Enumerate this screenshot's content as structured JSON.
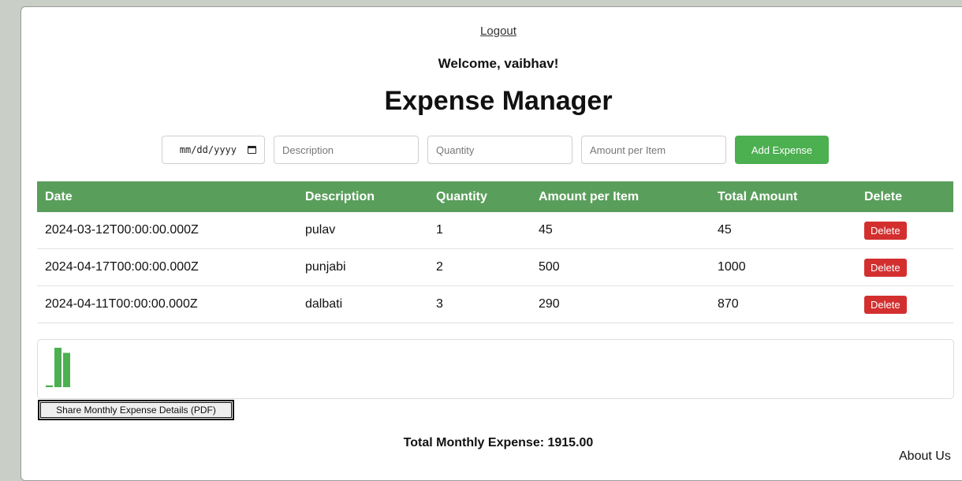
{
  "header": {
    "logout_label": "Logout",
    "welcome_text": "Welcome, vaibhav!",
    "title": "Expense Manager"
  },
  "form": {
    "date_placeholder": "mm/dd/yyyy",
    "description_placeholder": "Description",
    "quantity_placeholder": "Quantity",
    "amount_placeholder": "Amount per Item",
    "add_label": "Add Expense"
  },
  "table": {
    "columns": [
      "Date",
      "Description",
      "Quantity",
      "Amount per Item",
      "Total Amount",
      "Delete"
    ],
    "rows": [
      {
        "date": "2024-03-12T00:00:00.000Z",
        "description": "pulav",
        "quantity": "1",
        "amount": "45",
        "total": "45",
        "delete_label": "Delete"
      },
      {
        "date": "2024-04-17T00:00:00.000Z",
        "description": "punjabi",
        "quantity": "2",
        "amount": "500",
        "total": "1000",
        "delete_label": "Delete"
      },
      {
        "date": "2024-04-11T00:00:00.000Z",
        "description": "dalbati",
        "quantity": "3",
        "amount": "290",
        "total": "870",
        "delete_label": "Delete"
      }
    ]
  },
  "chart_data": {
    "type": "bar",
    "values": [
      45,
      1000,
      870
    ],
    "ylim": [
      0,
      1000
    ],
    "color": "#4caf50"
  },
  "share_label": "Share Monthly Expense Details (PDF)",
  "total_text": "Total Monthly Expense: 1915.00",
  "footer": {
    "about_label": "About Us"
  },
  "colors": {
    "header_green": "#5a9e5c",
    "button_green": "#4caf50",
    "delete_red": "#d32f2f"
  }
}
